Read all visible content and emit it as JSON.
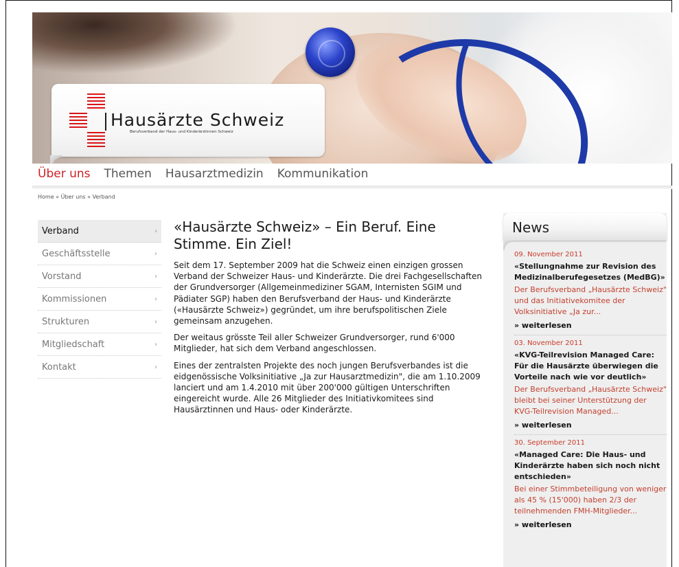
{
  "header": {
    "logo_title": "Hausärzte Schweiz",
    "logo_subtitle": "Berufsverband der Haus- und Kinderärztinnen Schweiz",
    "accent_color": "#cc2127",
    "stethoscope_color": "#1e3aa8"
  },
  "mainnav": {
    "items": [
      {
        "label": "Über uns",
        "active": true
      },
      {
        "label": "Themen",
        "active": false
      },
      {
        "label": "Hausarztmedizin",
        "active": false
      },
      {
        "label": "Kommunikation",
        "active": false
      }
    ]
  },
  "breadcrumb": "Home » Über uns » Verband",
  "sidebar": {
    "items": [
      {
        "label": "Verband",
        "active": true
      },
      {
        "label": "Geschäftsstelle",
        "active": false
      },
      {
        "label": "Vorstand",
        "active": false
      },
      {
        "label": "Kommissionen",
        "active": false
      },
      {
        "label": "Strukturen",
        "active": false
      },
      {
        "label": "Mitgliedschaft",
        "active": false
      },
      {
        "label": "Kontakt",
        "active": false
      }
    ],
    "chevron": "›"
  },
  "content": {
    "title": "«Hausärzte Schweiz» – Ein Beruf. Eine Stimme. Ein Ziel!",
    "paragraphs": [
      "Seit dem 17. September 2009 hat die Schweiz einen einzigen grossen Verband der Schweizer Haus- und Kinderärzte. Die drei Fachgesellschaften der Grundversorger (Allgemeinmediziner SGAM, Internisten SGIM und Pädiater SGP) haben den Berufsverband der Haus- und Kinderärzte («Hausärzte Schweiz») gegründet, um ihre berufspolitischen Ziele gemeinsam anzugehen.",
      "Der weitaus grösste Teil aller Schweizer Grundversorger, rund 6'000 Mitglieder, hat sich dem Verband angeschlossen.",
      "Eines der zentralsten Projekte des noch jungen Berufsverbandes ist die eidgenössische Volksinitiative „Ja zur Hausarztmedizin\", die am 1.10.2009 lanciert und am 1.4.2010 mit über 200'000 gültigen Unterschriften eingereicht wurde. Alle 26 Mitglieder des Initiativkomitees sind Hausärztinnen und Haus- oder Kinderärzte."
    ]
  },
  "news": {
    "heading": "News",
    "items": [
      {
        "date": "09. November 2011",
        "title": "«Stellungnahme zur Revision des Medizinalberufegesetzes (MedBG)»",
        "teaser": "Der Berufsverband „Hausärzte Schweiz\" und das Initiativekomitee der Volksinitiative „Ja zur...",
        "more": "» weiterlesen"
      },
      {
        "date": "03. November 2011",
        "title": "«KVG-Teilrevision Managed Care: Für die Hausärzte überwiegen die Vorteile nach wie vor deutlich»",
        "teaser": "Der Berufsverband „Hausärzte Schweiz\" bleibt bei seiner Unterstützung der KVG-Teilrevision Managed...",
        "more": "» weiterlesen"
      },
      {
        "date": "30. September 2011",
        "title": "«Managed Care: Die Haus- und Kinderärzte haben sich noch nicht entschieden»",
        "teaser": "Bei einer Stimmbeteiligung von weniger als 45 % (15'000) haben 2/3 der teilnehmenden FMH-Mitglieder...",
        "more": "» weiterlesen"
      }
    ]
  }
}
